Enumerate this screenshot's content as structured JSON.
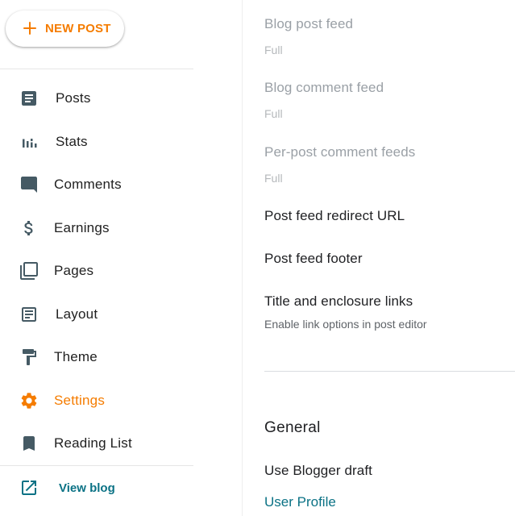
{
  "sidebar": {
    "new_post_label": "NEW POST",
    "items": [
      {
        "label": "Posts",
        "icon": "posts-icon"
      },
      {
        "label": "Stats",
        "icon": "stats-icon"
      },
      {
        "label": "Comments",
        "icon": "comments-icon"
      },
      {
        "label": "Earnings",
        "icon": "dollar-icon"
      },
      {
        "label": "Pages",
        "icon": "pages-icon"
      },
      {
        "label": "Layout",
        "icon": "layout-icon"
      },
      {
        "label": "Theme",
        "icon": "paint-roller-icon"
      },
      {
        "label": "Settings",
        "icon": "gear-icon",
        "active": true
      },
      {
        "label": "Reading List",
        "icon": "bookmark-icon"
      }
    ],
    "view_blog_label": "View blog"
  },
  "main": {
    "settings": [
      {
        "title": "Blog post feed",
        "value": "Full"
      },
      {
        "title": "Blog comment feed",
        "value": "Full"
      },
      {
        "title": "Per-post comment feeds",
        "value": "Full"
      },
      {
        "title": "Post feed redirect URL"
      },
      {
        "title": "Post feed footer"
      },
      {
        "title": "Title and enclosure links",
        "value": "Enable link options in post editor"
      }
    ],
    "general_heading": "General",
    "general_items": [
      {
        "title": "Use Blogger draft"
      }
    ],
    "user_profile_link": "User Profile"
  },
  "colors": {
    "accent_orange": "#f57c00",
    "link_teal": "#0b7285",
    "icon_gray": "#455a64",
    "text_primary": "#212121",
    "text_disabled": "#9aa0a6"
  }
}
